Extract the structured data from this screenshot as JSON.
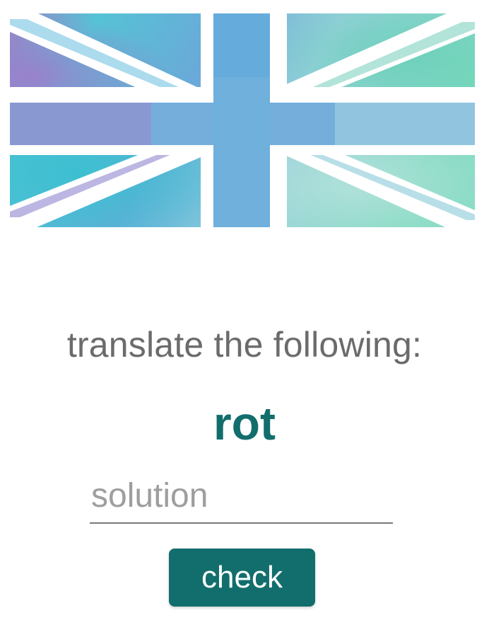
{
  "flag": {
    "icon": "union-jack-watercolor-flag",
    "colors": {
      "purple": "#9b82c6",
      "blue": "#6aa9d8",
      "cross": "#73aedb",
      "teal": "#44c9cf",
      "mint": "#8fdac1",
      "cross_white": "#ffffff"
    }
  },
  "quiz": {
    "prompt": "translate the following:",
    "word": "rot",
    "solution_value": "",
    "solution_placeholder": "solution",
    "check_label": "check"
  },
  "theme": {
    "accent": "#126e6c",
    "prompt_text": "#6b6b6b",
    "placeholder_text": "#9e9e9e"
  }
}
